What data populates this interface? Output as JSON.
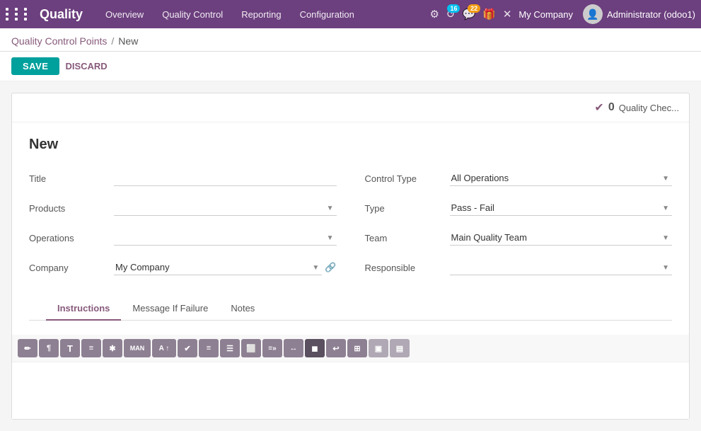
{
  "app": {
    "name": "Quality",
    "grid_icon": "grid-icon"
  },
  "topnav": {
    "menu_items": [
      "Overview",
      "Quality Control",
      "Reporting",
      "Configuration"
    ],
    "icons": [
      {
        "name": "settings-icon",
        "symbol": "⚙",
        "badge": null
      },
      {
        "name": "updates-icon",
        "symbol": "↺",
        "badge": "16",
        "badge_color": "teal"
      },
      {
        "name": "messages-icon",
        "symbol": "💬",
        "badge": "22",
        "badge_color": "orange"
      },
      {
        "name": "gift-icon",
        "symbol": "🎁",
        "badge": null
      },
      {
        "name": "close-icon",
        "symbol": "✕",
        "badge": null
      }
    ],
    "company": "My Company",
    "user": "Administrator (odoo1)"
  },
  "breadcrumb": {
    "parent_label": "Quality Control Points",
    "separator": "/",
    "current": "New"
  },
  "actions": {
    "save_label": "SAVE",
    "discard_label": "DISCARD"
  },
  "quality_checks": {
    "count": "0",
    "label": "Quality Chec..."
  },
  "form": {
    "title": "New",
    "fields": {
      "left": [
        {
          "label": "Title",
          "type": "text",
          "value": "",
          "name": "title-field"
        },
        {
          "label": "Products",
          "type": "select",
          "value": "",
          "name": "products-field"
        },
        {
          "label": "Operations",
          "type": "select",
          "value": "",
          "name": "operations-field"
        },
        {
          "label": "Company",
          "type": "select",
          "value": "My Company",
          "name": "company-field"
        }
      ],
      "right": [
        {
          "label": "Control Type",
          "type": "select",
          "value": "All Operations",
          "name": "control-type-field"
        },
        {
          "label": "Type",
          "type": "select",
          "value": "Pass - Fail",
          "name": "type-field"
        },
        {
          "label": "Team",
          "type": "select",
          "value": "Main Quality Team",
          "name": "team-field"
        },
        {
          "label": "Responsible",
          "type": "select",
          "value": "",
          "name": "responsible-field"
        }
      ]
    }
  },
  "tabs": [
    {
      "label": "Instructions",
      "name": "tab-instructions",
      "active": true
    },
    {
      "label": "Message If Failure",
      "name": "tab-message-if-failure",
      "active": false
    },
    {
      "label": "Notes",
      "name": "tab-notes",
      "active": false
    }
  ],
  "toolbar": {
    "buttons": [
      {
        "symbol": "✏",
        "name": "bold-btn",
        "shade": "medium"
      },
      {
        "symbol": "¶",
        "name": "paragraph-btn",
        "shade": "medium"
      },
      {
        "symbol": "T",
        "name": "text-btn",
        "shade": "medium"
      },
      {
        "symbol": "≡",
        "name": "list-btn",
        "shade": "medium"
      },
      {
        "symbol": "✱",
        "name": "star-btn",
        "shade": "medium"
      },
      {
        "symbol": "MAN",
        "name": "manual-btn",
        "shade": "medium"
      },
      {
        "symbol": "A↑",
        "name": "font-size-btn",
        "shade": "medium"
      },
      {
        "symbol": "✔",
        "name": "check-btn",
        "shade": "medium"
      },
      {
        "symbol": "≡",
        "name": "align-btn",
        "shade": "medium"
      },
      {
        "symbol": "☰",
        "name": "menu-btn",
        "shade": "medium"
      },
      {
        "symbol": "⬜",
        "name": "box-btn",
        "shade": "medium"
      },
      {
        "symbol": "≡»",
        "name": "indent-btn",
        "shade": "medium"
      },
      {
        "symbol": "↔",
        "name": "arrows-btn",
        "shade": "medium"
      },
      {
        "symbol": "◼",
        "name": "block-btn",
        "shade": "dark"
      },
      {
        "symbol": "↩",
        "name": "undo-btn",
        "shade": "medium"
      },
      {
        "symbol": "⊞",
        "name": "grid2-btn",
        "shade": "medium"
      },
      {
        "symbol": "▣",
        "name": "image-btn",
        "shade": "light"
      },
      {
        "symbol": "▤",
        "name": "table-btn",
        "shade": "light"
      }
    ]
  }
}
